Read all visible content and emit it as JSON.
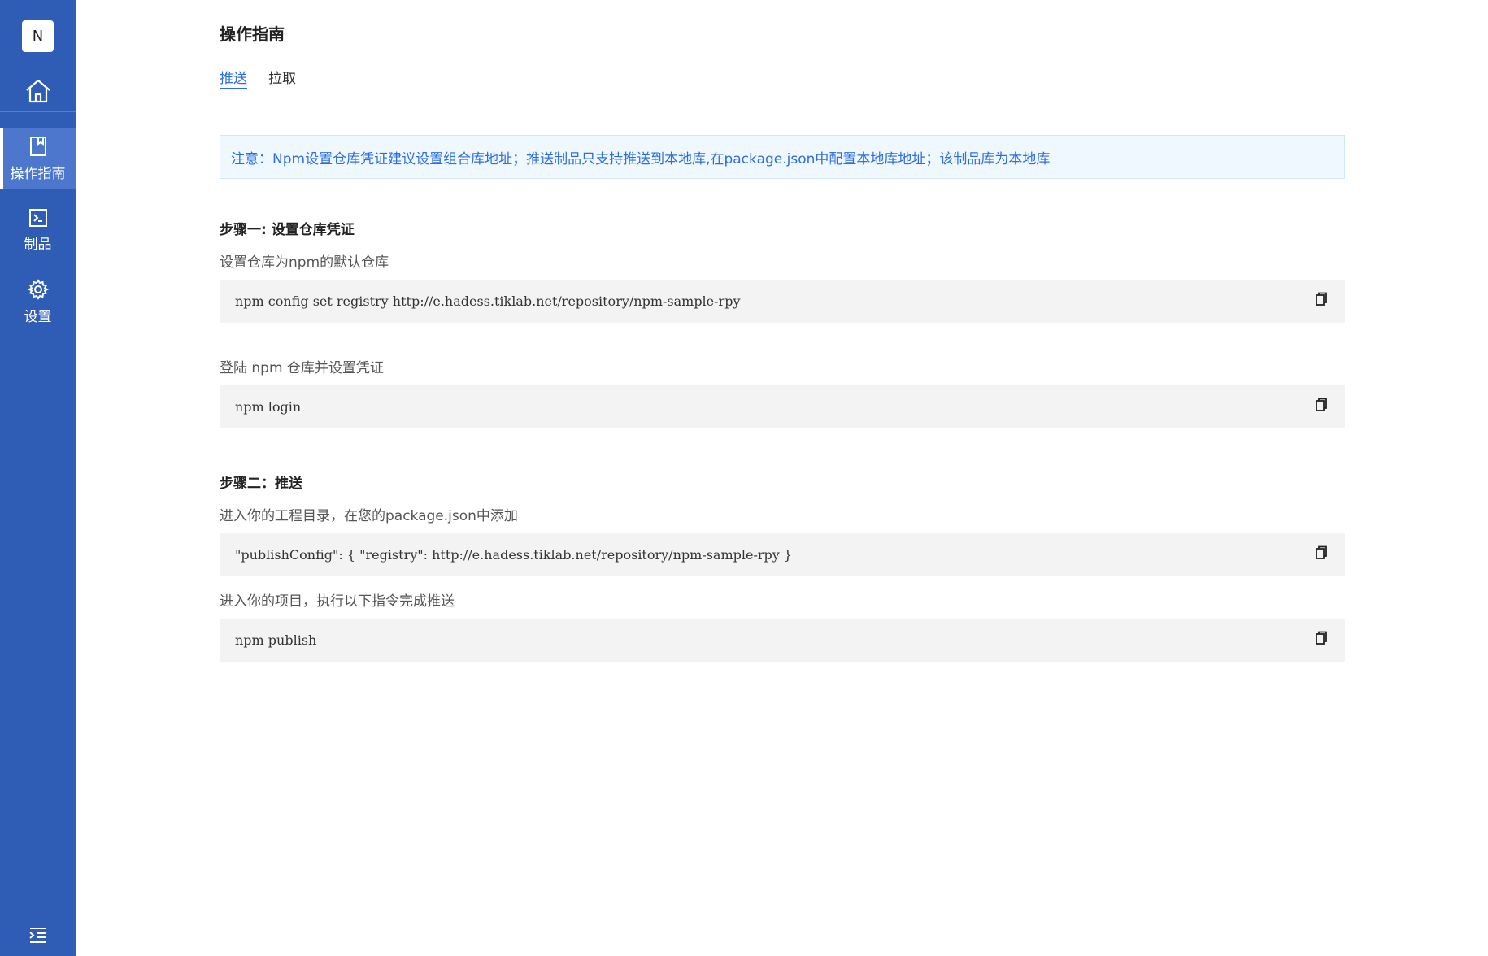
{
  "sidebar": {
    "logo_letter": "N",
    "items": [
      {
        "label": "操作指南",
        "icon": "book-icon",
        "active": true
      },
      {
        "label": "制品",
        "icon": "terminal-icon",
        "active": false
      },
      {
        "label": "设置",
        "icon": "gear-icon",
        "active": false
      }
    ],
    "home_icon": "home-icon",
    "collapse_icon": "menu-collapse-icon"
  },
  "main": {
    "title": "操作指南",
    "tabs": [
      {
        "label": "推送",
        "active": true
      },
      {
        "label": "拉取",
        "active": false
      }
    ],
    "notice": "注意：Npm设置仓库凭证建议设置组合库地址；推送制品只支持推送到本地库,在package.json中配置本地库地址；该制品库为本地库",
    "step1": {
      "title": "步骤一: 设置仓库凭证",
      "desc1": "设置仓库为npm的默认仓库",
      "code1": "npm config set registry http://e.hadess.tiklab.net/repository/npm-sample-rpy",
      "desc2": "登陆 npm 仓库并设置凭证",
      "code2": "npm login"
    },
    "step2": {
      "title": "步骤二：推送",
      "desc1": "进入你的工程目录，在您的package.json中添加",
      "code1": "\"publishConfig\": { \"registry\": http://e.hadess.tiklab.net/repository/npm-sample-rpy }",
      "desc2": "进入你的项目，执行以下指令完成推送",
      "code2": "npm publish"
    }
  },
  "colors": {
    "sidebar": "#2f5db6",
    "sidebar_active": "#4c77cd",
    "accent": "#2f6ee0",
    "notice_bg": "#eef8fe",
    "code_bg": "#f3f3f3"
  }
}
